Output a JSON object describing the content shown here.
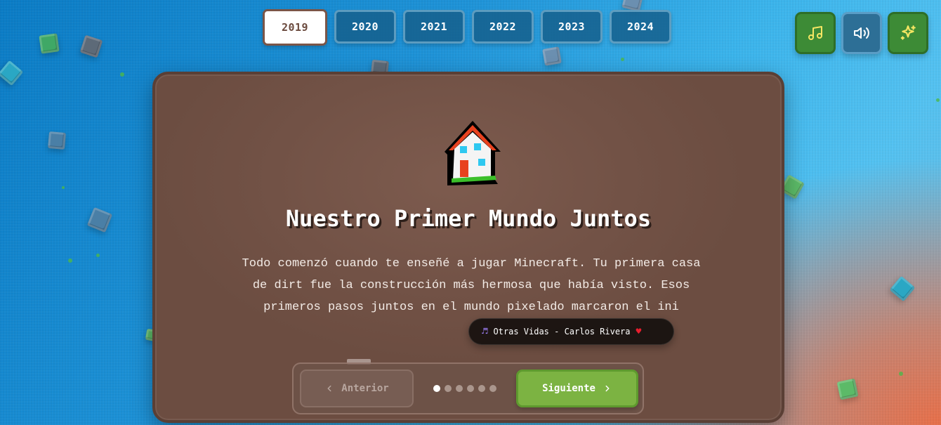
{
  "years": [
    "2019",
    "2020",
    "2021",
    "2022",
    "2023",
    "2024"
  ],
  "active_year": "2019",
  "controls": {
    "music_icon": "music-note-icon",
    "sound_icon": "speaker-icon",
    "sparkle_icon": "sparkles-icon"
  },
  "card": {
    "icon": "house-icon",
    "title": "Nuestro Primer Mundo Juntos",
    "text": "Todo comenzó cuando te enseñé a jugar Minecraft. Tu primera casa de dirt fue la construcción más hermosa que había visto. Esos primeros pasos juntos en el mundo pixelado marcaron el ini"
  },
  "song": {
    "note": "♬",
    "label": "Otras Vidas - Carlos Rivera",
    "heart": "♥"
  },
  "nav": {
    "prev_label": "Anterior",
    "next_label": "Siguiente",
    "pages": 6,
    "current_page": 1
  },
  "colors": {
    "accent_green": "#7cb342",
    "card_brown": "#725246",
    "sky_blue": "#1e93d8"
  }
}
